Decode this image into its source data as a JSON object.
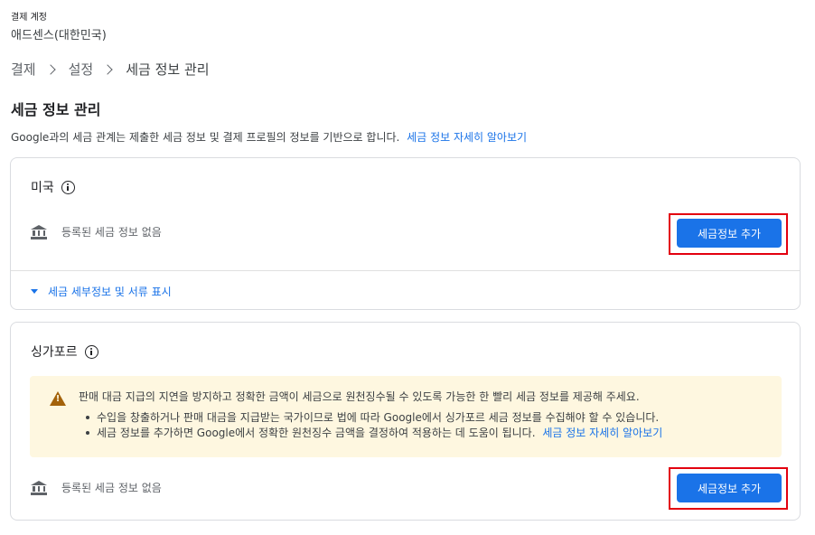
{
  "account": {
    "caption": "결제 계정",
    "name": "애드센스(대한민국)"
  },
  "breadcrumb": {
    "items": [
      "결제",
      "설정",
      "세금 정보 관리"
    ]
  },
  "page": {
    "title": "세금 정보 관리",
    "intro": "Google과의 세금 관계는 제출한 세금 정보 및 결제 프로필의 정보를 기반으로 합니다.",
    "intro_link": "세금 정보 자세히 알아보기"
  },
  "cards": {
    "us": {
      "title": "미국",
      "status": "등록된 세금 정보 없음",
      "button": "세금정보 추가",
      "expand_link": "세금 세부정보 및 서류 표시"
    },
    "sg": {
      "title": "싱가포르",
      "warning": {
        "main": "판매 대금 지급의 지연을 방지하고 정확한 금액이 세금으로 원천징수될 수 있도록 가능한 한 빨리 세금 정보를 제공해 주세요.",
        "bullet1": "수입을 창출하거나 판매 대금을 지급받는 국가이므로 법에 따라 Google에서 싱가포르 세금 정보를 수집해야 할 수 있습니다.",
        "bullet2": "세금 정보를 추가하면 Google에서 정확한 원천징수 금액을 결정하여 적용하는 데 도움이 됩니다.",
        "bullet2_link": "세금 정보 자세히 알아보기"
      },
      "status": "등록된 세금 정보 없음",
      "button": "세금정보 추가"
    }
  },
  "colors": {
    "primary": "#1a73e8",
    "highlight": "#e3000f",
    "warning_bg": "#fef7e0",
    "warning_icon": "#a3620a"
  }
}
